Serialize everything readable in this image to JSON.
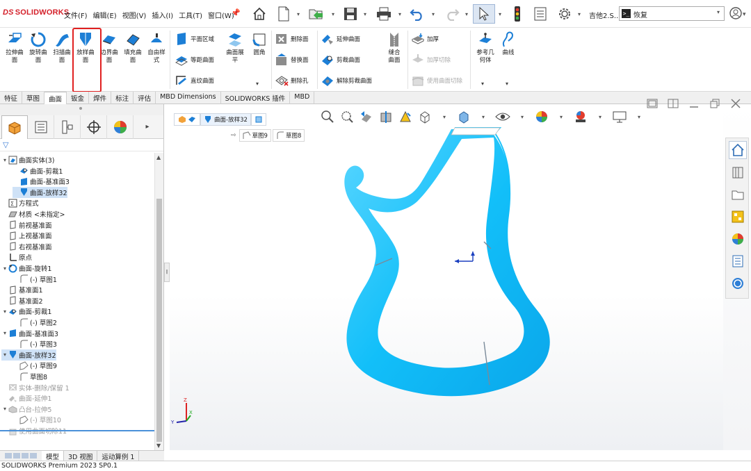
{
  "app": {
    "logo_ds": "DS",
    "logo_text": "SOLIDWORKS",
    "menu": [
      "文件(F)",
      "编辑(E)",
      "视图(V)",
      "插入(I)",
      "工具(T)",
      "窗口(W)"
    ],
    "user": "吉他2.S...",
    "search_value": "恢复",
    "status": "SOLIDWORKS Premium 2023 SP0.1"
  },
  "ribbon": {
    "big_buttons": [
      {
        "l1": "拉伸曲",
        "l2": "面",
        "icon": "extrude-surface-icon"
      },
      {
        "l1": "旋转曲",
        "l2": "面",
        "icon": "revolve-surface-icon"
      },
      {
        "l1": "扫描曲",
        "l2": "面",
        "icon": "sweep-surface-icon"
      },
      {
        "l1": "放样曲",
        "l2": "面",
        "icon": "loft-surface-icon"
      },
      {
        "l1": "边界曲",
        "l2": "面",
        "icon": "boundary-surface-icon"
      },
      {
        "l1": "填充曲",
        "l2": "面",
        "icon": "fill-surface-icon"
      },
      {
        "l1": "自由样",
        "l2": "式",
        "icon": "freeform-icon"
      }
    ],
    "group2": {
      "planar": "平面区域",
      "offset": "等距曲面",
      "ruled": "直纹曲面",
      "flatten_l1": "曲面展",
      "flatten_l2": "平",
      "fillet": "圆角"
    },
    "group3": {
      "delete_face": "删除面",
      "replace_face": "替换面",
      "delete_hole": "删除孔"
    },
    "group4": {
      "extend": "延伸曲面",
      "trim": "剪裁曲面",
      "untrim": "解除剪裁曲面",
      "knit_l1": "缝合",
      "knit_l2": "曲面"
    },
    "group5": {
      "thicken": "加厚",
      "thicken_cut": "加厚切除",
      "surface_cut": "使用曲面切除"
    },
    "group6": {
      "ref_l1": "参考几",
      "ref_l2": "何体",
      "curves": "曲线"
    }
  },
  "tabs": [
    "特征",
    "草图",
    "曲面",
    "钣金",
    "焊件",
    "标注",
    "评估",
    "MBD Dimensions",
    "SOLIDWORKS 插件",
    "MBD"
  ],
  "active_tab": "曲面",
  "tree": [
    {
      "text": "曲面实体(3)",
      "level": 0,
      "expand": "▾",
      "icon": "surface-bodies-icon"
    },
    {
      "text": "曲面-剪裁1",
      "level": 1,
      "expand": "",
      "icon": "trim-icon"
    },
    {
      "text": "曲面-基准面3",
      "level": 1,
      "expand": "",
      "icon": "plane-surface-icon"
    },
    {
      "text": "曲面-放样32",
      "level": 1,
      "expand": "",
      "icon": "loft-icon",
      "selected": true
    },
    {
      "text": "方程式",
      "level": 0,
      "expand": "",
      "icon": "equation-icon"
    },
    {
      "text": "材质 <未指定>",
      "level": 0,
      "expand": "",
      "icon": "material-icon"
    },
    {
      "text": "前视基准面",
      "level": 0,
      "expand": "",
      "icon": "plane-icon"
    },
    {
      "text": "上视基准面",
      "level": 0,
      "expand": "",
      "icon": "plane-icon"
    },
    {
      "text": "右视基准面",
      "level": 0,
      "expand": "",
      "icon": "plane-icon"
    },
    {
      "text": "原点",
      "level": 0,
      "expand": "",
      "icon": "origin-icon"
    },
    {
      "text": "曲面-旋转1",
      "level": 0,
      "expand": "▾",
      "icon": "revolve-icon"
    },
    {
      "text": "(-) 草图1",
      "level": 1,
      "expand": "",
      "icon": "sketch-icon"
    },
    {
      "text": "基准面1",
      "level": 0,
      "expand": "",
      "icon": "plane-icon"
    },
    {
      "text": "基准面2",
      "level": 0,
      "expand": "",
      "icon": "plane-icon"
    },
    {
      "text": "曲面-剪裁1",
      "level": 0,
      "expand": "▾",
      "icon": "trim-icon"
    },
    {
      "text": "(-) 草图2",
      "level": 1,
      "expand": "",
      "icon": "sketch-icon"
    },
    {
      "text": "曲面-基准面3",
      "level": 0,
      "expand": "▾",
      "icon": "plane-surface-icon"
    },
    {
      "text": "(-) 草图3",
      "level": 1,
      "expand": "",
      "icon": "sketch-icon"
    },
    {
      "text": "曲面-放样32",
      "level": 0,
      "expand": "▾",
      "icon": "loft-icon",
      "selected": true
    },
    {
      "text": "(-) 草图9",
      "level": 1,
      "expand": "",
      "icon": "3dsketch-icon"
    },
    {
      "text": "草图8",
      "level": 1,
      "expand": "",
      "icon": "sketch-icon"
    },
    {
      "text": "实体-删除/保留 1",
      "level": 0,
      "expand": "",
      "icon": "delete-body-icon",
      "gray": true
    },
    {
      "text": "曲面-延伸1",
      "level": 0,
      "expand": "",
      "icon": "extend-icon",
      "gray": true
    },
    {
      "text": "凸台-拉伸5",
      "level": 0,
      "expand": "▾",
      "icon": "boss-icon",
      "gray": true
    },
    {
      "text": "(-) 草图10",
      "level": 1,
      "expand": "",
      "icon": "3dsketch-icon",
      "gray": true
    },
    {
      "text": "使用曲面切除11",
      "level": 0,
      "expand": "",
      "icon": "surface-cut-icon",
      "gray": true
    }
  ],
  "breadcrumb": {
    "feature": "曲面-放样32",
    "sketch9": "草图9",
    "sketch8": "草图8"
  },
  "bottom_tabs": [
    "模型",
    "3D 视图",
    "运动算例 1"
  ],
  "triad": {
    "x": "X",
    "y": "Y",
    "z": "Z"
  },
  "colors": {
    "accent": "#2e6cc0",
    "surface": "#1fc3ff",
    "highlight_box": "#e02020",
    "selection": "#cfe2f7"
  }
}
